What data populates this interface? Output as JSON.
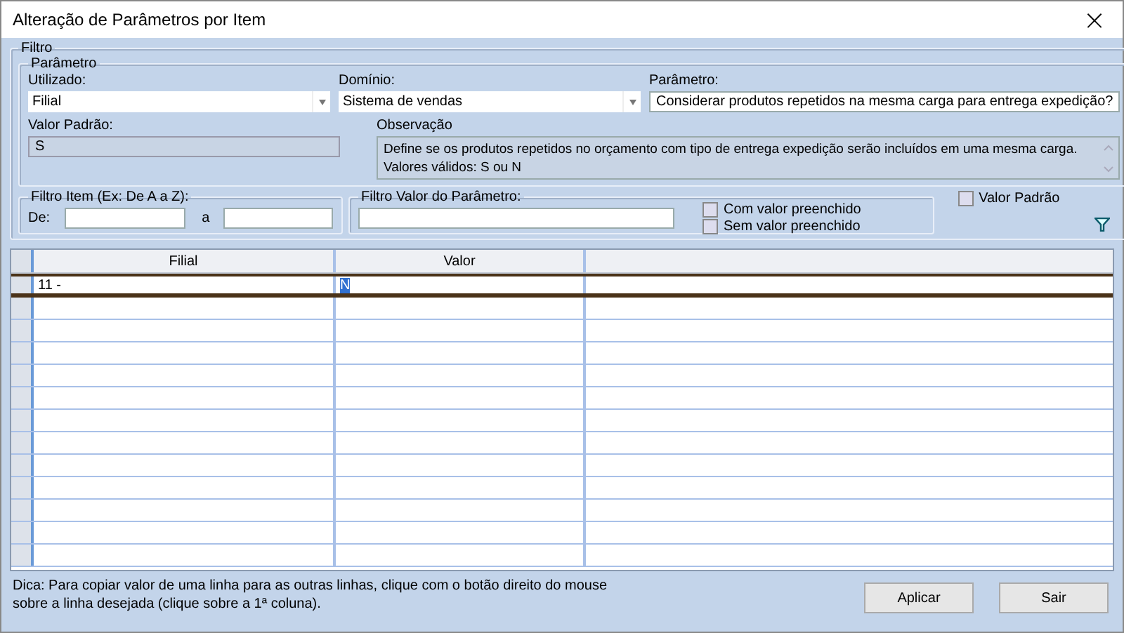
{
  "window": {
    "title": "Alteração de Parâmetros por Item",
    "close": "×"
  },
  "filter": {
    "legend": "Filtro",
    "parameter_group": {
      "legend": "Parâmetro",
      "used": {
        "label": "Utilizado:",
        "value": "Filial"
      },
      "domain": {
        "label": "Domínio:",
        "value": "Sistema de vendas"
      },
      "parameter": {
        "label": "Parâmetro:",
        "value": "Considerar produtos repetidos na mesma carga para entrega expedição?"
      },
      "default_value": {
        "label": "Valor Padrão:",
        "value": "S"
      },
      "observation": {
        "label": "Observação",
        "value": "Define se os produtos repetidos no orçamento com tipo de entrega expedição serão incluídos em uma mesma carga. Valores válidos: S ou N"
      }
    },
    "item_filter": {
      "legend": "Filtro Item (Ex: De A a Z):",
      "from_label": "De:",
      "to_label": "a"
    },
    "value_filter": {
      "legend": "Filtro Valor do Parâmetro:",
      "options": [
        {
          "label": "Com valor preenchido",
          "checked": false
        },
        {
          "label": "Sem valor preenchido",
          "checked": false
        }
      ]
    },
    "default_value_check": {
      "label": "Valor Padrão",
      "checked": false
    }
  },
  "table": {
    "columns": [
      "Filial",
      "Valor"
    ],
    "rows": [
      {
        "filial": "11 -",
        "valor": "N",
        "selected": true
      }
    ]
  },
  "hint": "Dica: Para copiar valor de uma linha para as outras linhas, clique com o botão direito do mouse sobre a linha desejada (clique sobre a 1ª coluna).",
  "buttons": [
    "Aplicar",
    "Sair"
  ]
}
